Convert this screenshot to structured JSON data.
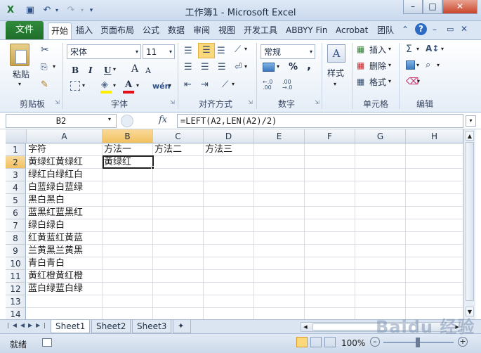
{
  "window": {
    "title": "工作簿1 - Microsoft Excel"
  },
  "ribbon_tabs": {
    "file": "文件",
    "items": [
      "开始",
      "插入",
      "页面布局",
      "公式",
      "数据",
      "审阅",
      "视图",
      "开发工具",
      "ABBYY Fin",
      "Acrobat",
      "团队"
    ]
  },
  "clipboard": {
    "paste": "粘贴",
    "label": "剪贴板"
  },
  "font": {
    "name": "宋体",
    "size": "11",
    "label": "字体",
    "bold": "B",
    "italic": "I",
    "underline": "U",
    "grow": "A",
    "shrink": "A",
    "wen": "wén"
  },
  "alignment": {
    "label": "对齐方式"
  },
  "number": {
    "format": "常规",
    "label": "数字",
    "percent": "%",
    "comma": ",",
    "inc": ".0\n.00",
    "dec": ".00\n.0"
  },
  "styles": {
    "label": "样式"
  },
  "cells": {
    "insert": "插入",
    "delete": "删除",
    "format": "格式",
    "label": "单元格"
  },
  "editing": {
    "label": "编辑"
  },
  "formula_bar": {
    "name_box": "B2",
    "fx": "fx",
    "formula": "=LEFT(A2,LEN(A2)/2)"
  },
  "columns": [
    "A",
    "B",
    "C",
    "D",
    "E",
    "F",
    "G",
    "H"
  ],
  "rows": [
    {
      "n": "1",
      "a": "字符",
      "b": "方法一",
      "c": "方法二",
      "d": "方法三"
    },
    {
      "n": "2",
      "a": "黄绿红黄绿红",
      "b": "黄绿红",
      "c": "",
      "d": ""
    },
    {
      "n": "3",
      "a": "绿红白绿红白",
      "b": "",
      "c": "",
      "d": ""
    },
    {
      "n": "4",
      "a": "白蓝绿白蓝绿",
      "b": "",
      "c": "",
      "d": ""
    },
    {
      "n": "5",
      "a": "黑白黑白",
      "b": "",
      "c": "",
      "d": ""
    },
    {
      "n": "6",
      "a": "蓝黑红蓝黑红",
      "b": "",
      "c": "",
      "d": ""
    },
    {
      "n": "7",
      "a": "绿白绿白",
      "b": "",
      "c": "",
      "d": ""
    },
    {
      "n": "8",
      "a": "红黄蓝红黄蓝",
      "b": "",
      "c": "",
      "d": ""
    },
    {
      "n": "9",
      "a": "兰黄黑兰黄黑",
      "b": "",
      "c": "",
      "d": ""
    },
    {
      "n": "10",
      "a": "青白青白",
      "b": "",
      "c": "",
      "d": ""
    },
    {
      "n": "11",
      "a": "黄红橙黄红橙",
      "b": "",
      "c": "",
      "d": ""
    },
    {
      "n": "12",
      "a": "蓝白绿蓝白绿",
      "b": "",
      "c": "",
      "d": ""
    },
    {
      "n": "13",
      "a": "",
      "b": "",
      "c": "",
      "d": ""
    },
    {
      "n": "14",
      "a": "",
      "b": "",
      "c": "",
      "d": ""
    }
  ],
  "sheets": [
    "Sheet1",
    "Sheet2",
    "Sheet3"
  ],
  "status": {
    "mode": "就绪",
    "zoom": "100%"
  },
  "watermark": "Baidu 经验"
}
